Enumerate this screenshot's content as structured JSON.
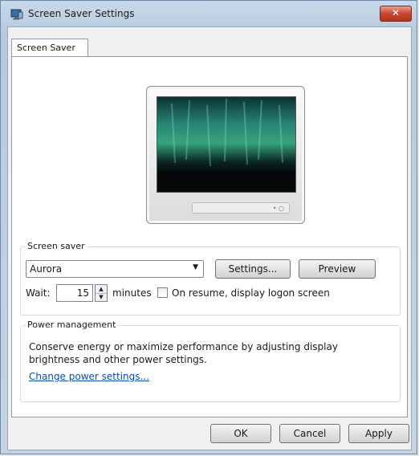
{
  "window": {
    "title": "Screen Saver Settings",
    "close_glyph": "✕"
  },
  "tabs": [
    {
      "label": "Screen Saver"
    }
  ],
  "preview": {
    "screensaver_name": "Aurora"
  },
  "screen_saver_group": {
    "label": "Screen saver",
    "selected": "Aurora",
    "settings_button": "Settings...",
    "preview_button": "Preview",
    "wait_label": "Wait:",
    "wait_value": "15",
    "minutes_label": "minutes",
    "resume_checkbox_label": "On resume, display logon screen",
    "resume_checked": false
  },
  "power_group": {
    "label": "Power management",
    "description": "Conserve energy or maximize performance by adjusting display brightness and other power settings.",
    "link": "Change power settings..."
  },
  "footer": {
    "ok": "OK",
    "cancel": "Cancel",
    "apply": "Apply"
  },
  "colors": {
    "link": "#0a4fa8",
    "close_button": "#c9462f",
    "aurora_green": "#3fbf8f"
  }
}
